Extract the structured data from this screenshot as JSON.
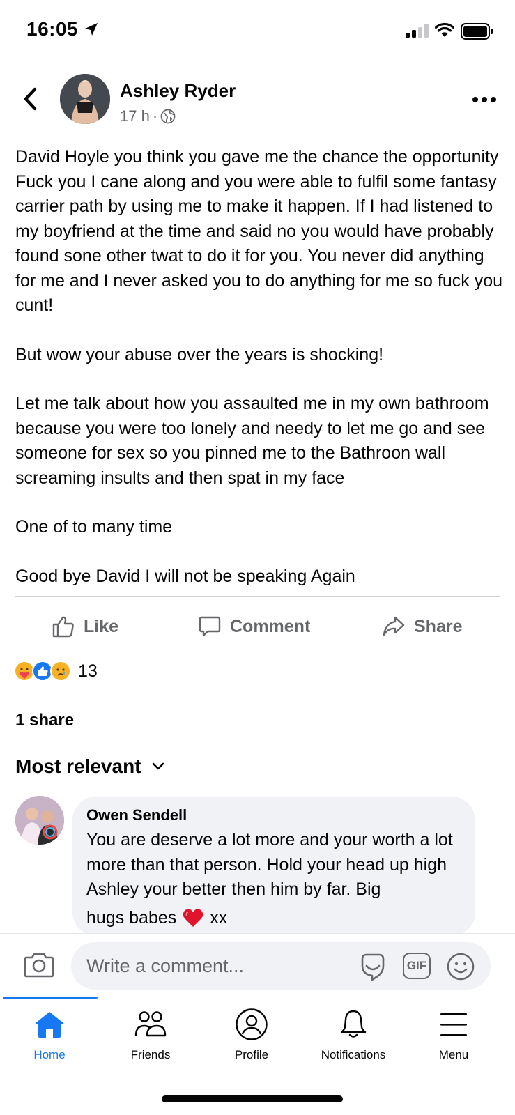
{
  "status_bar": {
    "time": "16:05"
  },
  "post": {
    "author": "Ashley Ryder",
    "time_ago": "17 h",
    "separator": "·",
    "paragraphs": [
      "David Hoyle you think you gave me the chance the opportunity Fuck you I cane along and you were able to fulfil some fantasy carrier path by using me to make it happen. If I had listened to my boyfriend at the time and said no you would have probably found sone other twat to do it for you. You never did anything for me and I never asked you to do anything for me so fuck you cunt!",
      "But wow your abuse over the years is shocking!",
      "Let me talk about how you assaulted me in my own bathroom because you were too lonely and needy to let me go and see someone for sex so you pinned me to the Bathroon wall screaming insults and then spat in my face",
      "One of to many time",
      "Good bye David I will not be speaking Again"
    ]
  },
  "actions": {
    "like": "Like",
    "comment": "Comment",
    "share": "Share"
  },
  "reactions": {
    "count": "13",
    "icons": [
      "care-icon",
      "like-reaction-icon",
      "sad-icon"
    ]
  },
  "shares": "1 share",
  "sort_label": "Most relevant",
  "comment": {
    "author": "Owen Sendell",
    "text": "You are deserve a lot more and your worth a lot more than that person. Hold your head up high Ashley your better then him by far. Big",
    "text_end": "hugs babes",
    "emoji": "❤️",
    "suffix": "xx"
  },
  "composer": {
    "placeholder": "Write a comment...",
    "gif_label": "GIF"
  },
  "tabs": [
    {
      "label": "Home",
      "icon": "home-icon",
      "active": true
    },
    {
      "label": "Friends",
      "icon": "friends-icon",
      "active": false
    },
    {
      "label": "Profile",
      "icon": "profile-icon",
      "active": false
    },
    {
      "label": "Notifications",
      "icon": "bell-icon",
      "active": false
    },
    {
      "label": "Menu",
      "icon": "menu-icon",
      "active": false
    }
  ],
  "colors": {
    "accent": "#1877f2",
    "secondary_text": "#65676b",
    "bubble": "#f0f2f5"
  }
}
